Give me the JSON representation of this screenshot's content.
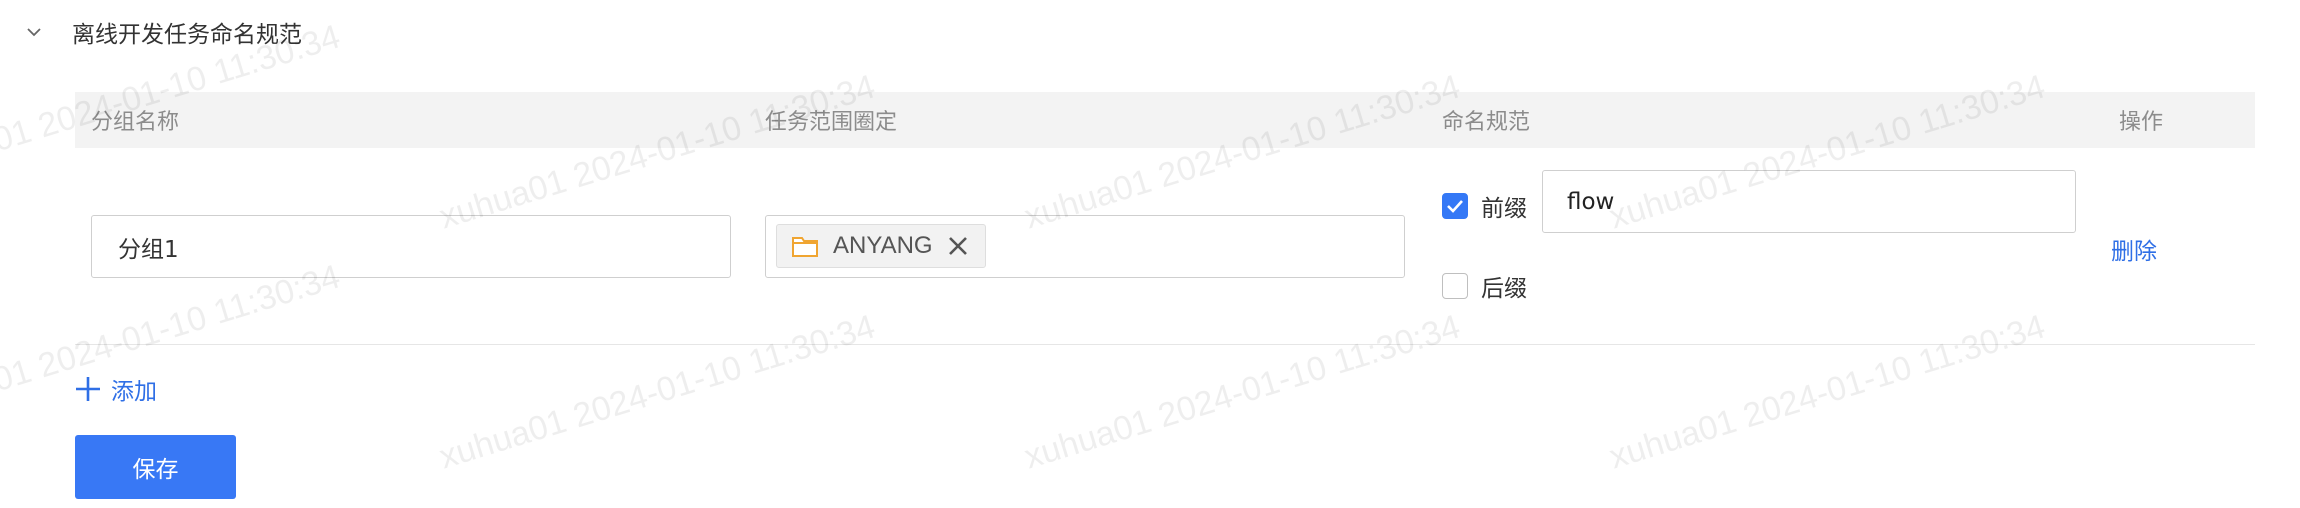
{
  "section": {
    "title": "离线开发任务命名规范",
    "collapse_icon": "chevron-down-icon"
  },
  "table": {
    "headers": {
      "group_name": "分组名称",
      "scope": "任务范围圈定",
      "naming_rule": "命名规范",
      "action": "操作"
    },
    "rows": [
      {
        "group_name": "分组1",
        "scope_tag": {
          "icon": "folder-icon",
          "label": "ANYANG"
        },
        "prefix": {
          "label": "前缀",
          "checked": true,
          "value": "flow"
        },
        "suffix": {
          "label": "后缀",
          "checked": false
        },
        "delete_label": "删除"
      }
    ]
  },
  "add_label": "添加",
  "save_label": "保存",
  "watermark": "xuhua01 2024-01-10 11:30:34",
  "colors": {
    "primary": "#3478f6",
    "link": "#2f6fe6",
    "header_bg": "#f3f3f3",
    "folder": "#f0a531"
  }
}
